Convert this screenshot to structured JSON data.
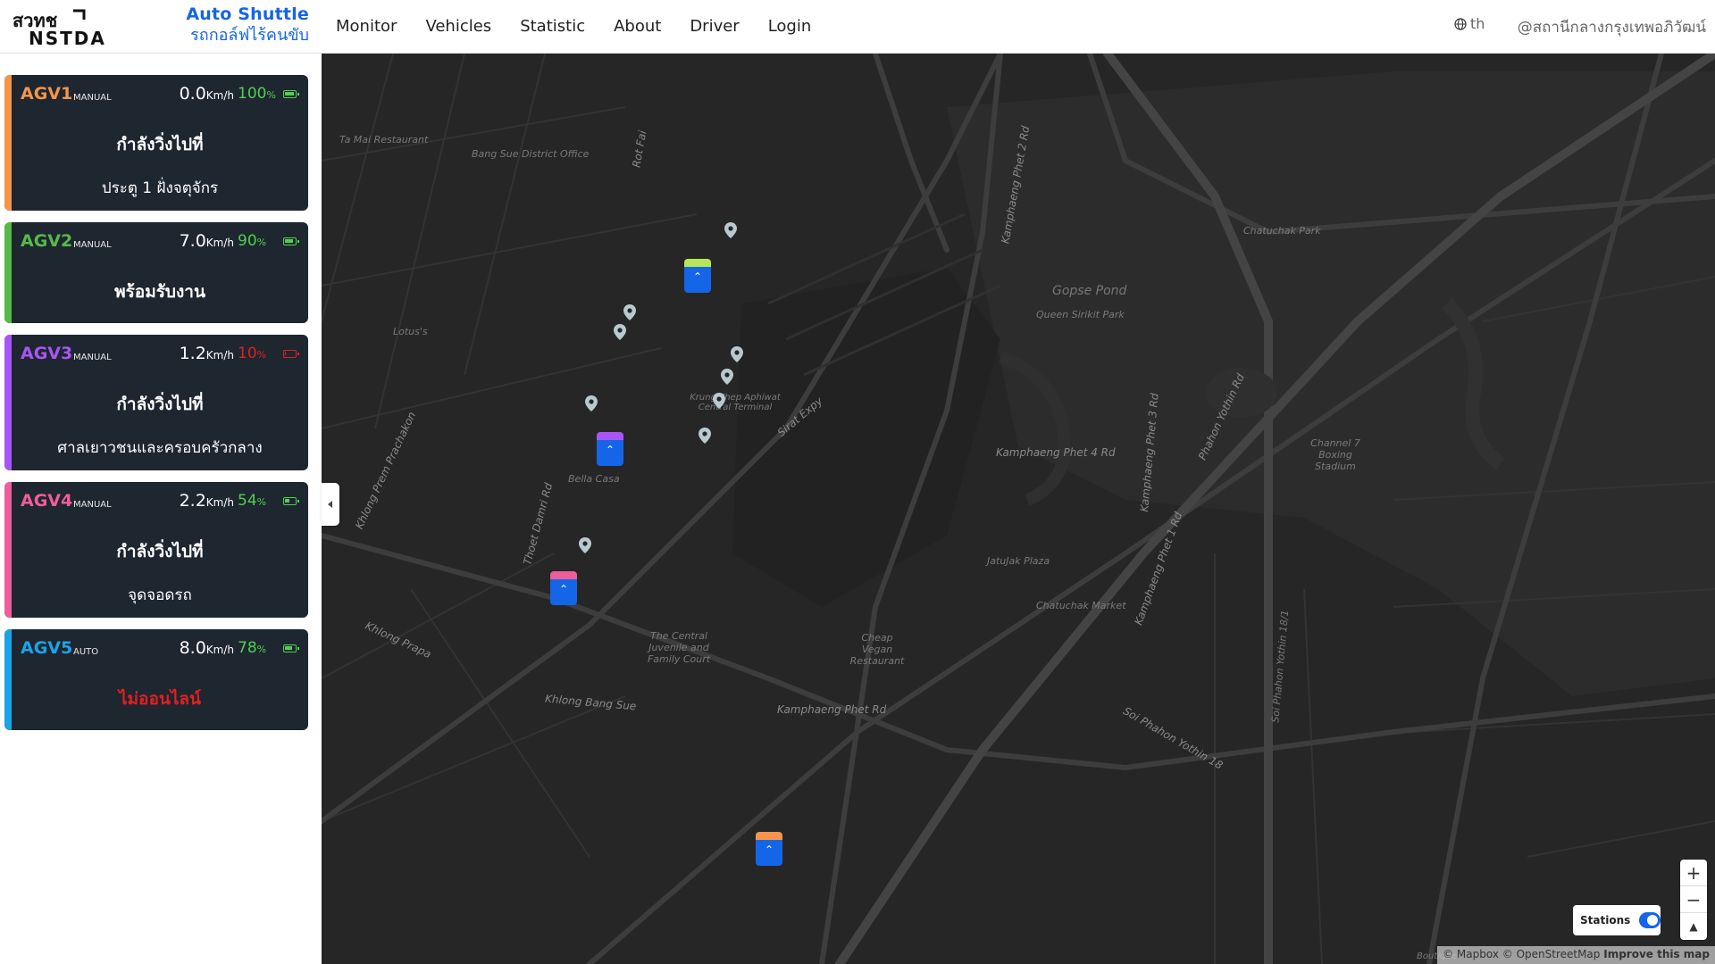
{
  "header": {
    "logo_text": "สวทช NSTDA",
    "brand_title": "Auto Shuttle",
    "brand_subtitle": "รถกอล์ฟไร้คนขับ",
    "nav": [
      "Monitor",
      "Vehicles",
      "Statistic",
      "About",
      "Driver",
      "Login"
    ],
    "language": "th",
    "location": "@สถานีกลางกรุงเทพอภิวัฒน์"
  },
  "vehicles": [
    {
      "name": "AGV1",
      "mode": "MANUAL",
      "speed": "0.0",
      "speed_unit": "Km/h",
      "battery": "100",
      "battery_unit": "%",
      "battery_level": 1.0,
      "status": "กำลังวิ่งไปที่",
      "destination": "ประตู 1 ฝั่งจตุจักร",
      "color": "#f5944a",
      "battery_color": "#4fd04f"
    },
    {
      "name": "AGV2",
      "mode": "MANUAL",
      "speed": "7.0",
      "speed_unit": "Km/h",
      "battery": "90",
      "battery_unit": "%",
      "battery_level": 0.9,
      "status": "พร้อมรับงาน",
      "destination": "",
      "color": "#57b947",
      "battery_color": "#4fd04f"
    },
    {
      "name": "AGV3",
      "mode": "MANUAL",
      "speed": "1.2",
      "speed_unit": "Km/h",
      "battery": "10",
      "battery_unit": "%",
      "battery_level": 0.1,
      "status": "กำลังวิ่งไปที่",
      "destination": "ศาลเยาวชนและครอบครัวกลาง",
      "color": "#a855f7",
      "battery_color": "#e02020"
    },
    {
      "name": "AGV4",
      "mode": "MANUAL",
      "speed": "2.2",
      "speed_unit": "Km/h",
      "battery": "54",
      "battery_unit": "%",
      "battery_level": 0.54,
      "status": "กำลังวิ่งไปที่",
      "destination": "จุดจอดรถ",
      "color": "#ee5e9b",
      "battery_color": "#4fd04f"
    },
    {
      "name": "AGV5",
      "mode": "AUTO",
      "speed": "8.0",
      "speed_unit": "Km/h",
      "battery": "78",
      "battery_unit": "%",
      "battery_level": 0.78,
      "status": "ไม่ออนไลน์",
      "destination": "",
      "color": "#1aa4e8",
      "battery_color": "#4fd04f",
      "status_color": "#e02020"
    }
  ],
  "map": {
    "labels": [
      "Ta Mai Restaurant",
      "Bang Sue District Office",
      "Lotus's",
      "Krung Thep Aphiwat Central Terminal",
      "Bella Casa",
      "The Central Juvenile and Family Court",
      "Khlong Prapa",
      "Khlong Bang Sue",
      "Kamphaeng Phet Rd",
      "Sirat Expy",
      "Kamphaeng Phet 2 Rd",
      "Kamphaeng Phet 3 Rd",
      "Kamphaeng Phet 4 Rd",
      "Kamphaeng Phet 1 Rd",
      "Chatuchak Park",
      "Gopse Pond",
      "Queen Sirikit Park",
      "Phahon Yothin Rd",
      "Channel 7 Boxing Stadium",
      "JatuJak Plaza",
      "Chatuchak Market",
      "Cheap Vegan Restaurant",
      "Rot Fai",
      "Thoet Damri Rd",
      "Khlong Prem Prachakon",
      "Soi Phahon Yothin 18",
      "Soi Phahon Yothin 18/1",
      "Boutique"
    ],
    "stations_label": "Stations",
    "stations_on": true,
    "zoom_in": "+",
    "zoom_out": "−",
    "compass": "▲",
    "attribution": "© Mapbox © OpenStreetMap",
    "attribution_link": "Improve this map"
  }
}
